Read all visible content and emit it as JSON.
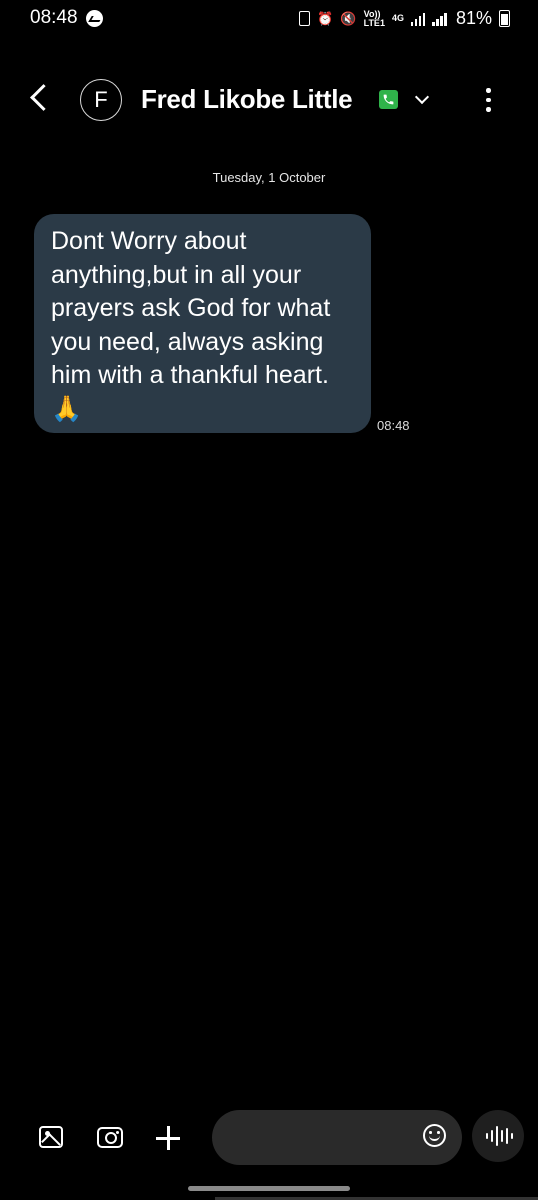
{
  "status_bar": {
    "time": "08:48",
    "network_top": "Vo))",
    "network_bottom": "LTE1",
    "network_type": "4G",
    "battery_percent": "81%",
    "icons": [
      "messenger-icon",
      "battery-saver-icon",
      "alarm-icon",
      "mute-icon",
      "signal-icon",
      "battery-icon"
    ]
  },
  "header": {
    "avatar_initial": "F",
    "contact_name": "Fred Likobe Little",
    "icons": [
      "back-icon",
      "phone-badge-icon",
      "chevron-down-icon",
      "more-icon"
    ],
    "badge_color": "#2fb34a"
  },
  "conversation": {
    "date_label": "Tuesday, 1 October",
    "messages": [
      {
        "text": "Dont Worry about anything,but in all your prayers ask God for what you need, always asking him with a thankful heart.🙏",
        "time": "08:48",
        "bubble_color": "#2b3a47"
      }
    ]
  },
  "composer": {
    "placeholder": "",
    "icons": [
      "gallery-icon",
      "camera-icon",
      "plus-icon",
      "emoji-icon",
      "voice-icon"
    ]
  }
}
